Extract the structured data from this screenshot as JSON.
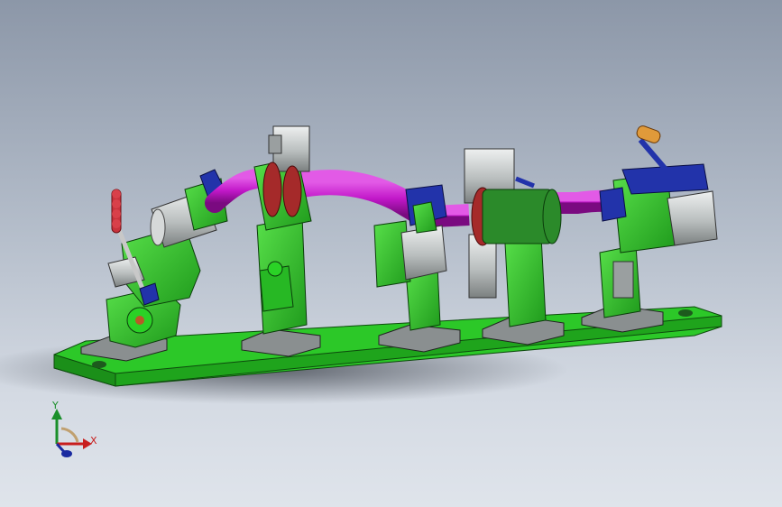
{
  "viewport": {
    "background_top": "#8c97a8",
    "background_bottom": "#dfe4eb"
  },
  "model": {
    "fixture_color": "#2fcf2b",
    "tube_color": "#c218c9",
    "clamp_color": "#2233aa",
    "cylinder_color": "#c8cccc",
    "flange_color": "#a52a2a",
    "handle_color": "#c8323c",
    "lever_grip_color": "#e09a3a"
  },
  "triad": {
    "y_label": "Y",
    "x_label": "X",
    "y_color": "#1a8f2a",
    "x_color": "#c81e1e",
    "z_color": "#1a2aa0"
  }
}
